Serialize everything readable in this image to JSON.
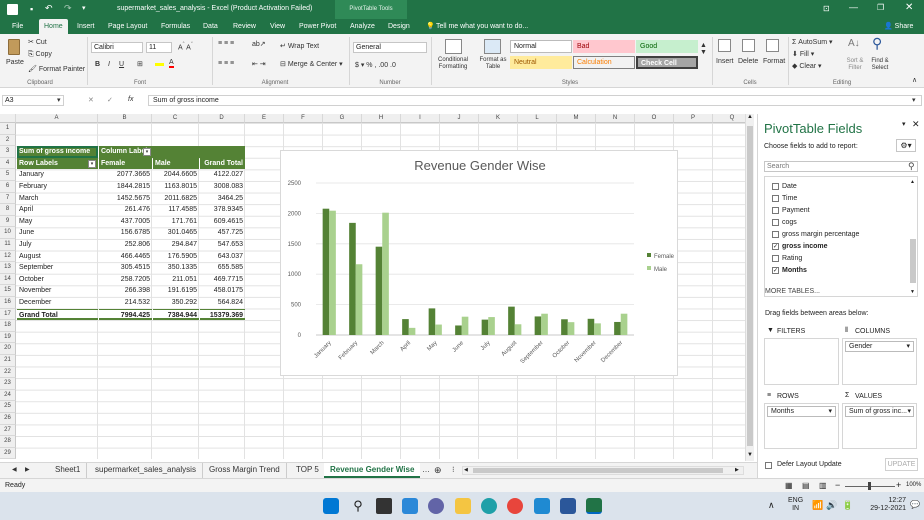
{
  "titlebar": {
    "file_name": "supermarket_sales_analysis - Excel (Product Activation Failed)",
    "context_tab": "PivotTable Tools",
    "restore_icon": "restore-icon"
  },
  "ribbon_tabs": [
    "File",
    "Home",
    "Insert",
    "Page Layout",
    "Formulas",
    "Data",
    "Review",
    "View",
    "Power Pivot",
    "Analyze",
    "Design"
  ],
  "tell_me": "Tell me what you want to do...",
  "share": "Share",
  "ribbon": {
    "cut": "Cut",
    "copy": "Copy",
    "format_painter": "Format Painter",
    "paste": "Paste",
    "clipboard": "Clipboard",
    "font_name": "Calibri",
    "font_size": "11",
    "font": "Font",
    "wrap_text": "Wrap Text",
    "merge_center": "Merge & Center",
    "alignment": "Alignment",
    "number_format": "General",
    "number": "Number",
    "conditional_formatting": "Conditional Formatting",
    "format_as_table": "Format as Table",
    "style_normal": "Normal",
    "style_bad": "Bad",
    "style_good": "Good",
    "style_neutral": "Neutral",
    "style_calculation": "Calculation",
    "style_check_cell": "Check Cell",
    "styles": "Styles",
    "insert": "Insert",
    "delete": "Delete",
    "format": "Format",
    "cells": "Cells",
    "autosum": "AutoSum",
    "fill": "Fill",
    "clear": "Clear",
    "sort_filter": "Sort & Filter",
    "find_select": "Find & Select",
    "editing": "Editing"
  },
  "formula_bar": {
    "name_box": "A3",
    "formula": "Sum of gross income",
    "fx": "fx"
  },
  "columns": [
    "A",
    "B",
    "C",
    "D",
    "E",
    "F",
    "G",
    "H",
    "I",
    "J",
    "K",
    "L",
    "M",
    "N",
    "O",
    "P",
    "Q"
  ],
  "rows": [
    "1",
    "2",
    "3",
    "4",
    "5",
    "6",
    "7",
    "8",
    "9",
    "10",
    "11",
    "12",
    "13",
    "14",
    "15",
    "16",
    "17",
    "18",
    "19",
    "20",
    "21",
    "22",
    "23",
    "24",
    "25",
    "26",
    "27",
    "28",
    "29"
  ],
  "pivot_table": {
    "value_header": "Sum of gross income",
    "column_labels": "Column Labels",
    "row_labels": "Row Labels",
    "headers": [
      "Female",
      "Male",
      "Grand Total"
    ],
    "data": [
      [
        "January",
        "2077.3665",
        "2044.6605",
        "4122.027"
      ],
      [
        "February",
        "1844.2815",
        "1163.8015",
        "3008.083"
      ],
      [
        "March",
        "1452.5675",
        "2011.6825",
        "3464.25"
      ],
      [
        "April",
        "261.476",
        "117.4585",
        "378.9345"
      ],
      [
        "May",
        "437.7005",
        "171.761",
        "609.4615"
      ],
      [
        "June",
        "156.6785",
        "301.0465",
        "457.725"
      ],
      [
        "July",
        "252.806",
        "294.847",
        "547.653"
      ],
      [
        "August",
        "466.4465",
        "176.5905",
        "643.037"
      ],
      [
        "September",
        "305.4515",
        "350.1335",
        "655.585"
      ],
      [
        "October",
        "258.7205",
        "211.051",
        "469.7715"
      ],
      [
        "November",
        "266.398",
        "191.6195",
        "458.0175"
      ],
      [
        "December",
        "214.532",
        "350.292",
        "564.824"
      ]
    ],
    "total": [
      "Grand Total",
      "7994.425",
      "7384.944",
      "15379.369"
    ]
  },
  "chart_data": {
    "type": "bar",
    "title": "Revenue Gender Wise",
    "categories": [
      "January",
      "February",
      "March",
      "April",
      "May",
      "June",
      "July",
      "August",
      "September",
      "October",
      "November",
      "December"
    ],
    "series": [
      {
        "name": "Female",
        "color": "#548235",
        "values": [
          2077.3665,
          1844.2815,
          1452.5675,
          261.476,
          437.7005,
          156.6785,
          252.806,
          466.4465,
          305.4515,
          258.7205,
          266.398,
          214.532
        ]
      },
      {
        "name": "Male",
        "color": "#a9d18e",
        "values": [
          2044.6605,
          1163.8015,
          2011.6825,
          117.4585,
          171.761,
          301.0465,
          294.847,
          176.5905,
          350.1335,
          211.051,
          191.6195,
          350.292
        ]
      }
    ],
    "ylim": [
      0,
      2500
    ],
    "yticks": [
      "0",
      "500",
      "1000",
      "1500",
      "2000",
      "2500"
    ],
    "legend": "right",
    "grid": true
  },
  "pivot_pane": {
    "title": "PivotTable Fields",
    "subtitle": "Choose fields to add to report:",
    "search_placeholder": "Search",
    "fields": [
      {
        "name": "Date",
        "checked": false
      },
      {
        "name": "Time",
        "checked": false
      },
      {
        "name": "Payment",
        "checked": false
      },
      {
        "name": "cogs",
        "checked": false
      },
      {
        "name": "gross margin percentage",
        "checked": false
      },
      {
        "name": "gross income",
        "checked": true
      },
      {
        "name": "Rating",
        "checked": false
      },
      {
        "name": "Months",
        "checked": true
      }
    ],
    "more_tables": "MORE TABLES...",
    "drag_label": "Drag fields between areas below:",
    "filters": "FILTERS",
    "columns": "COLUMNS",
    "columns_item": "Gender",
    "rows": "ROWS",
    "rows_item": "Months",
    "values": "VALUES",
    "values_item": "Sum of gross inc...",
    "defer": "Defer Layout Update",
    "update": "UPDATE"
  },
  "sheet_tabs": [
    "Sheet1",
    "supermarket_sales_analysis",
    "Gross Margin Trend",
    "TOP 5",
    "Revenue Gender Wise"
  ],
  "active_sheet": "Revenue Gender Wise",
  "status": {
    "ready": "Ready",
    "zoom": "100%"
  },
  "taskbar": {
    "lang1": "ENG",
    "lang2": "IN",
    "time": "12:27",
    "date": "29-12-2021"
  }
}
